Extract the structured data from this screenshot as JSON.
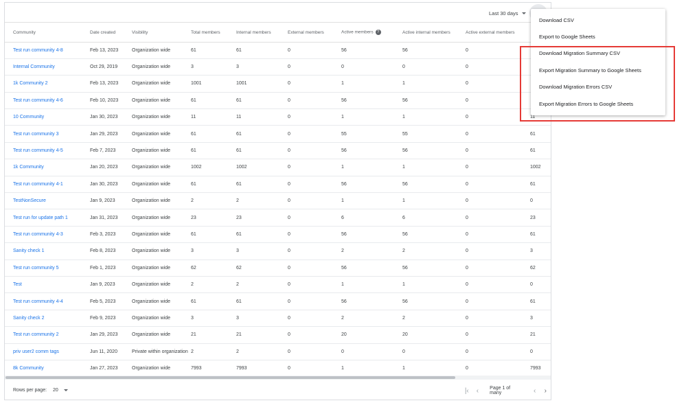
{
  "topbar": {
    "date_range": "Last 30 days"
  },
  "table": {
    "headers": [
      "Community",
      "Date created",
      "Visibility",
      "Total members",
      "Internal members",
      "External members",
      "Active members",
      "Active internal members",
      "Active external members",
      ""
    ],
    "rows": [
      [
        "Test run community 4-8",
        "Feb 13, 2023",
        "Organization wide",
        "61",
        "61",
        "0",
        "56",
        "56",
        "0",
        ""
      ],
      [
        "Internal Community",
        "Oct 29, 2019",
        "Organization wide",
        "3",
        "3",
        "0",
        "0",
        "0",
        "0",
        ""
      ],
      [
        "1k Community 2",
        "Feb 13, 2023",
        "Organization wide",
        "1001",
        "1001",
        "0",
        "1",
        "1",
        "0",
        ""
      ],
      [
        "Test run community 4-6",
        "Feb 10, 2023",
        "Organization wide",
        "61",
        "61",
        "0",
        "56",
        "56",
        "0",
        ""
      ],
      [
        "10 Community",
        "Jan 30, 2023",
        "Organization wide",
        "11",
        "11",
        "0",
        "1",
        "1",
        "0",
        "11"
      ],
      [
        "Test run community 3",
        "Jan 29, 2023",
        "Organization wide",
        "61",
        "61",
        "0",
        "55",
        "55",
        "0",
        "61"
      ],
      [
        "Test run community 4-5",
        "Feb 7, 2023",
        "Organization wide",
        "61",
        "61",
        "0",
        "56",
        "56",
        "0",
        "61"
      ],
      [
        "1k Community",
        "Jan 20, 2023",
        "Organization wide",
        "1002",
        "1002",
        "0",
        "1",
        "1",
        "0",
        "1002"
      ],
      [
        "Test run community 4-1",
        "Jan 30, 2023",
        "Organization wide",
        "61",
        "61",
        "0",
        "56",
        "56",
        "0",
        "61"
      ],
      [
        "TestNonSecure",
        "Jan 9, 2023",
        "Organization wide",
        "2",
        "2",
        "0",
        "1",
        "1",
        "0",
        "0"
      ],
      [
        "Test run for update path 1",
        "Jan 31, 2023",
        "Organization wide",
        "23",
        "23",
        "0",
        "6",
        "6",
        "0",
        "23"
      ],
      [
        "Test run community 4-3",
        "Feb 3, 2023",
        "Organization wide",
        "61",
        "61",
        "0",
        "56",
        "56",
        "0",
        "61"
      ],
      [
        "Sanity check 1",
        "Feb 8, 2023",
        "Organization wide",
        "3",
        "3",
        "0",
        "2",
        "2",
        "0",
        "3"
      ],
      [
        "Test run community 5",
        "Feb 1, 2023",
        "Organization wide",
        "62",
        "62",
        "0",
        "56",
        "56",
        "0",
        "62"
      ],
      [
        "Test",
        "Jan 9, 2023",
        "Organization wide",
        "2",
        "2",
        "0",
        "1",
        "1",
        "0",
        "0"
      ],
      [
        "Test run community 4-4",
        "Feb 5, 2023",
        "Organization wide",
        "61",
        "61",
        "0",
        "56",
        "56",
        "0",
        "61"
      ],
      [
        "Sanity check 2",
        "Feb 9, 2023",
        "Organization wide",
        "3",
        "3",
        "0",
        "2",
        "2",
        "0",
        "3"
      ],
      [
        "Test run community 2",
        "Jan 29, 2023",
        "Organization wide",
        "21",
        "21",
        "0",
        "20",
        "20",
        "0",
        "21"
      ],
      [
        "priv user2 comm tags",
        "Jun 11, 2020",
        "Private within organization",
        "2",
        "2",
        "0",
        "0",
        "0",
        "0",
        "0"
      ],
      [
        "8k Community",
        "Jan 27, 2023",
        "Organization wide",
        "7993",
        "7993",
        "0",
        "1",
        "1",
        "0",
        "7993"
      ]
    ]
  },
  "footer": {
    "rows_per_page_label": "Rows per page:",
    "rows_per_page": "20",
    "page_label": "Page 1 of many"
  },
  "menu": {
    "items": [
      "Download CSV",
      "Export to Google Sheets",
      "Download Migration Summary CSV",
      "Export Migration Summary to Google Sheets",
      "Download Migration Errors CSV",
      "Export Migration Errors to Google Sheets"
    ]
  },
  "icons": {
    "more": "more-vert-icon",
    "help": "help-icon",
    "first": "first-page-icon",
    "prev": "chevron-left-icon",
    "next": "chevron-right-icon"
  },
  "colors": {
    "link": "#1a73e8",
    "highlight": "#e53935"
  }
}
